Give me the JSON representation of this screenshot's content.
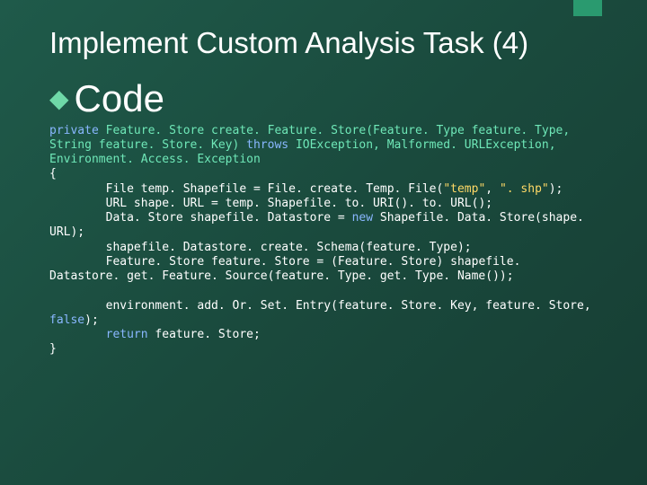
{
  "slide": {
    "title": "Implement Custom Analysis Task (4)",
    "bullet_label": "Code",
    "code": {
      "l1_kw": "private",
      "l1_rest": " Feature. Store create. Feature. Store(Feature. Type feature. Type, String feature. Store. Key) ",
      "l1_throws": "throws",
      "l1_after_throws": " IOException, Malformed. URLException, Environment. Access. Exception",
      "l2": "{",
      "l3": "        File temp. Shapefile = File. create. Temp. File(",
      "l3_str1": "\"temp\"",
      "l3_mid": ", ",
      "l3_str2": "\". shp\"",
      "l3_end": ");",
      "l4": "        URL shape. URL = temp. Shapefile. to. URI(). to. URL();",
      "l5a": "        Data. Store shapefile. Datastore = ",
      "l5_kw": "new",
      "l5b": " Shapefile. Data. Store(shape. URL);",
      "l6": "        shapefile. Datastore. create. Schema(feature. Type);",
      "l7": "        Feature. Store feature. Store = (Feature. Store) shapefile. Datastore. get. Feature. Source(feature. Type. get. Type. Name());",
      "l8": "",
      "l9a": "        environment. add. Or. Set. Entry(feature. Store. Key, feature. Store, ",
      "l9_kw": "false",
      "l9b": ");",
      "l10a": "        ",
      "l10_kw": "return",
      "l10b": " feature. Store;",
      "l11": "}"
    }
  }
}
